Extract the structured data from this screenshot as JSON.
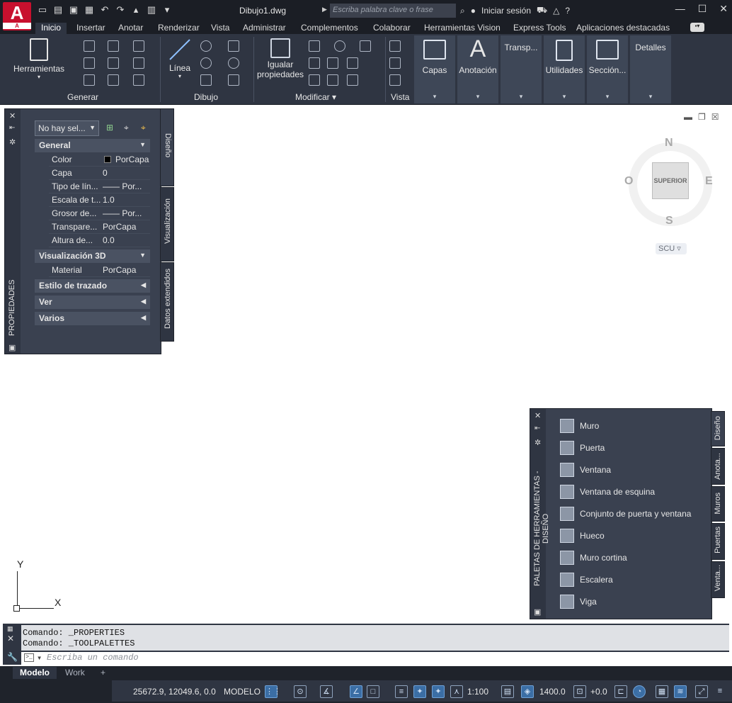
{
  "titlebar": {
    "app_logo": "A",
    "app_logo_sub": "A",
    "document": "Dibujo1.dwg",
    "search_placeholder": "Escriba palabra clave o frase",
    "sign_in": "Iniciar sesión"
  },
  "ribbon_tabs": [
    "Inicio",
    "Insertar",
    "Anotar",
    "Renderizar",
    "Vista",
    "Administrar",
    "Complementos",
    "Colaborar",
    "Herramientas Vision",
    "Express Tools",
    "Aplicaciones destacadas"
  ],
  "ribbon": {
    "herramientas": "Herramientas",
    "generar": "Generar",
    "linea": "Línea",
    "dibujo": "Dibujo",
    "igualar_1": "Igualar",
    "igualar_2": "propiedades",
    "modificar": "Modificar",
    "vista": "Vista",
    "capas": "Capas",
    "anotacion": "Anotación",
    "transp": "Transp...",
    "utilidades": "Utilidades",
    "seccion": "Sección...",
    "detalles": "Detalles"
  },
  "properties": {
    "palette_title": "PROPIEDADES",
    "selection": "No hay sel...",
    "tabs": [
      "Diseño",
      "Visualización",
      "Datos extendidos"
    ],
    "general": "General",
    "rows": [
      {
        "k": "Color",
        "v": "PorCapa"
      },
      {
        "k": "Capa",
        "v": "0"
      },
      {
        "k": "Tipo de lín...",
        "v": "—— Por..."
      },
      {
        "k": "Escala de t...",
        "v": "1.0"
      },
      {
        "k": "Grosor de...",
        "v": "—— Por..."
      },
      {
        "k": "Transpare...",
        "v": "PorCapa"
      },
      {
        "k": "Altura de...",
        "v": "0.0"
      }
    ],
    "vis3d": "Visualización 3D",
    "material_k": "Material",
    "material_v": "PorCapa",
    "estilo": "Estilo de trazado",
    "ver": "Ver",
    "varios": "Varios"
  },
  "viewcube": {
    "n": "N",
    "s": "S",
    "e": "E",
    "o": "O",
    "face": "SUPERIOR",
    "scu": "SCU"
  },
  "ucs": {
    "x": "X",
    "y": "Y"
  },
  "tool_palette": {
    "title": "PALETAS DE HERRAMIENTAS - DISEÑO",
    "tabs": [
      "Diseño",
      "Anota...",
      "Muros",
      "Puertas",
      "Venta..."
    ],
    "items": [
      "Muro",
      "Puerta",
      "Ventana",
      "Ventana de esquina",
      "Conjunto de puerta y ventana",
      "Hueco",
      "Muro cortina",
      "Escalera",
      "Viga"
    ]
  },
  "command": {
    "history": [
      "Comando:  _PROPERTIES",
      "Comando:  _TOOLPALETTES"
    ],
    "placeholder": "Escriba un comando"
  },
  "layouts": {
    "model": "Modelo",
    "work": "Work",
    "add": "+"
  },
  "status": {
    "coords": "25672.9, 12049.6, 0.0",
    "space": "MODELO",
    "scale": "1:100",
    "elevation": "1400.0",
    "offset": "+0.0"
  }
}
